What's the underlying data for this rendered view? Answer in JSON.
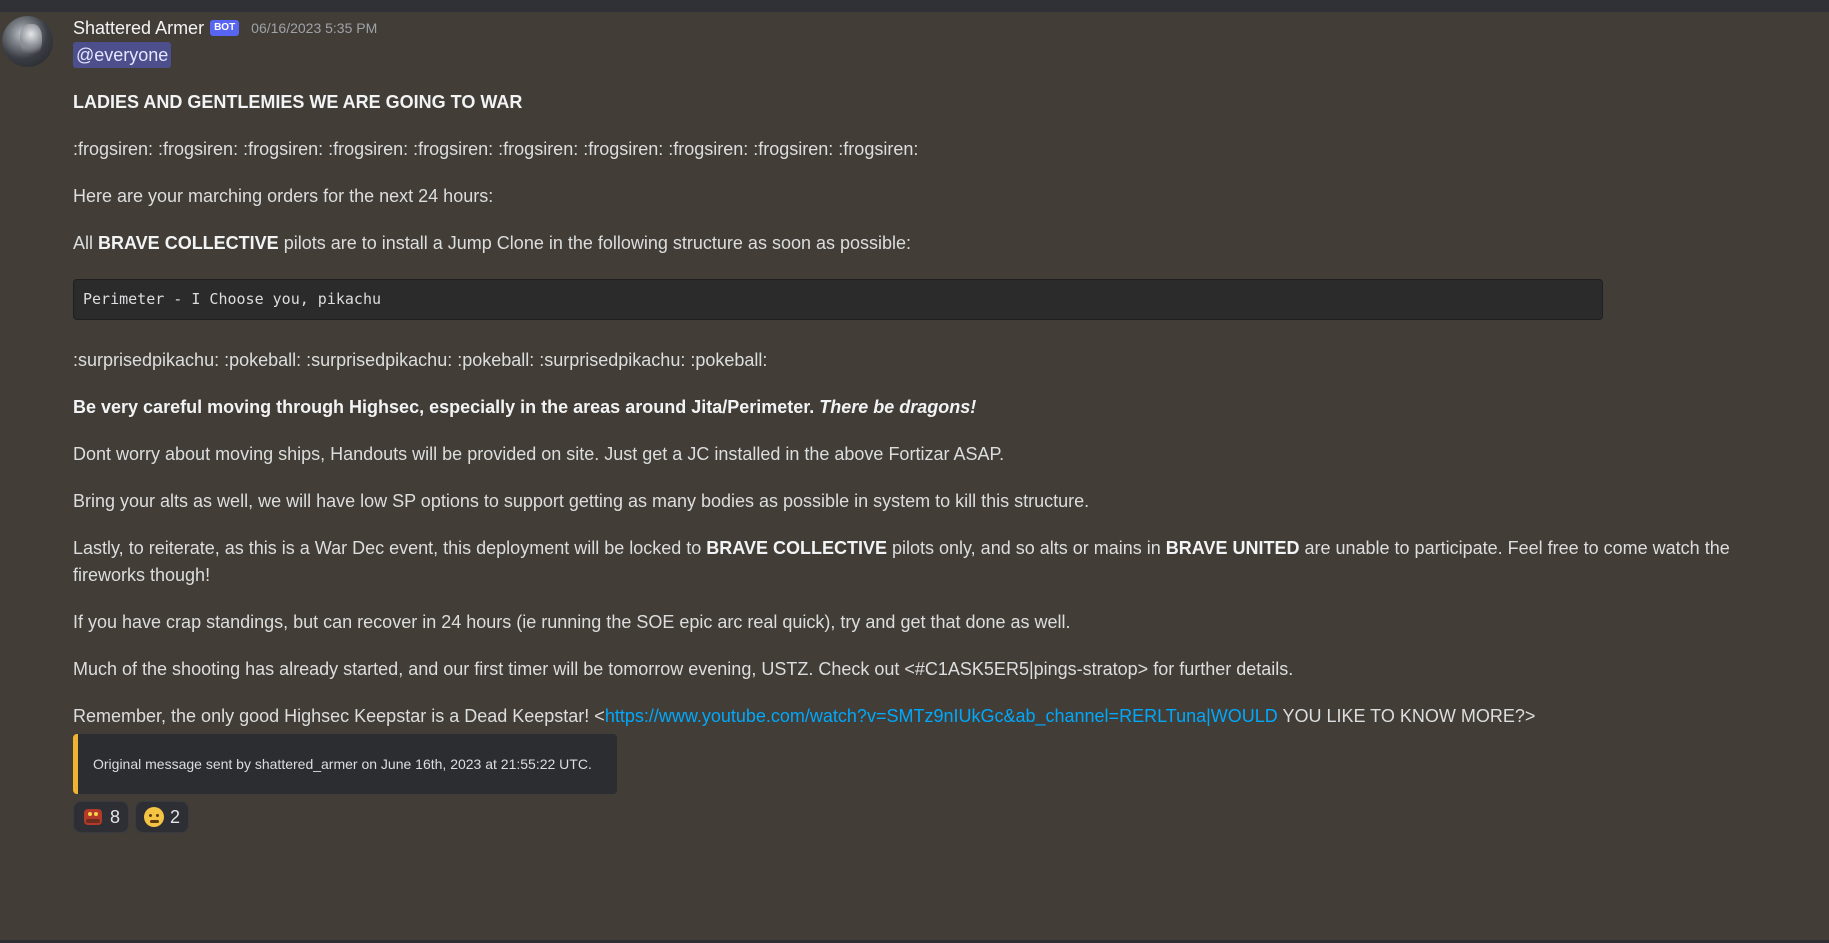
{
  "message": {
    "username": "Shattered Armer",
    "bot_tag": "BOT",
    "timestamp": "06/16/2023 5:35 PM",
    "mention": "@everyone",
    "heading": "LADIES AND GENTLEMIES WE ARE GOING TO WAR",
    "frog_line": ":frogsiren: :frogsiren: :frogsiren: :frogsiren: :frogsiren: :frogsiren: :frogsiren: :frogsiren: :frogsiren: :frogsiren:",
    "orders": "Here are your marching orders for the next 24 hours:",
    "jc_prefix": "All ",
    "jc_bold": "BRAVE COLLECTIVE",
    "jc_suffix": " pilots are to install a Jump Clone in the following structure as soon as possible:",
    "code": "Perimeter - I Choose you, pikachu",
    "pikachu_line": ":surprisedpikachu: :pokeball: :surprisedpikachu: :pokeball: :surprisedpikachu: :pokeball:",
    "careful_bold": "Be very careful moving through Highsec, especially in the areas around Jita/Perimeter. ",
    "careful_italic": "There be dragons!",
    "ships": "Dont worry about moving ships, Handouts will be provided on site. Just get a JC installed in the above Fortizar ASAP.",
    "alts": "Bring your alts as well, we will have low SP options to support getting as many bodies as possible in system to kill this structure.",
    "lastly_1": "Lastly, to reiterate, as this is a War Dec event, this deployment will be locked to ",
    "lastly_bold1": "BRAVE COLLECTIVE",
    "lastly_2": " pilots only, and so alts or mains in ",
    "lastly_bold2": "BRAVE UNITED",
    "lastly_3": " are unable to participate. Feel free to come watch the fireworks though!",
    "standings": "If you have crap standings, but can recover in 24 hours (ie running the SOE epic arc real quick), try and get that done as well.",
    "shooting": "Much of the shooting has already started, and our first timer will be tomorrow evening, USTZ. Check out <#C1ASK5ER5|pings-stratop> for further details.",
    "remember_prefix": "Remember, the only good Highsec Keepstar is a Dead Keepstar! <",
    "remember_link": "https://www.youtube.com/watch?v=SMTz9nIUkGc&ab_channel=RERLTuna|WOULD",
    "remember_suffix": " YOU LIKE TO KNOW MORE?>",
    "embed_text": "Original message sent by shattered_armer on June 16th, 2023 at 21:55:22 UTC.",
    "reactions": [
      {
        "emoji": "frogsiren-icon",
        "count": "8"
      },
      {
        "emoji": "grimace-face-icon",
        "count": "2"
      }
    ]
  },
  "colors": {
    "background": "#423e37",
    "mention_bg": "#4d4f8c",
    "link": "#00a8fc",
    "embed_border": "#f0b232",
    "bot_tag": "#5865f2"
  }
}
